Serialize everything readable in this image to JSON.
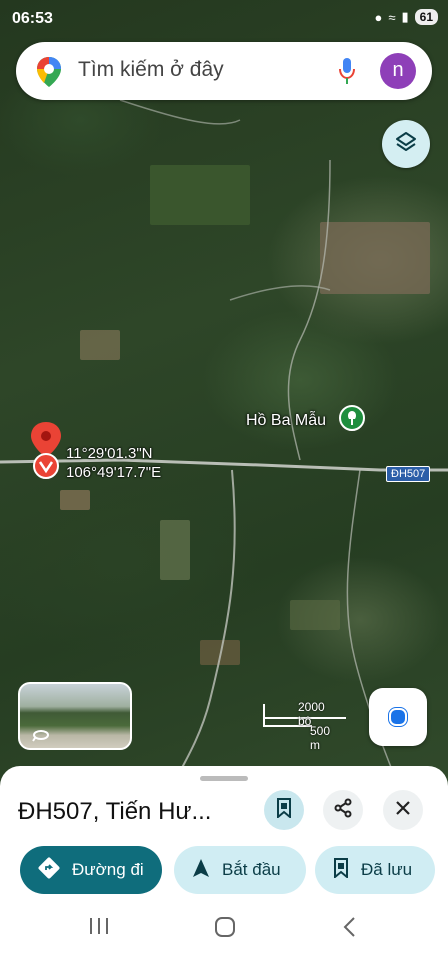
{
  "status_bar": {
    "time": "06:53",
    "battery": "61"
  },
  "search": {
    "placeholder": "Tìm kiếm ở đây",
    "avatar_letter": "n"
  },
  "map": {
    "coordinates_lat": "11°29'01.3\"N",
    "coordinates_lng": "106°49'17.7\"E",
    "poi_label": "Hồ Ba Mẫu",
    "road_badge": "ĐH507",
    "scale_feet": "2000 bộ",
    "scale_meters": "500 m"
  },
  "sheet": {
    "place_title": "ĐH507, Tiến Hư...",
    "buttons": {
      "directions": "Đường đi",
      "start": "Bắt đầu",
      "saved": "Đã lưu"
    }
  },
  "colors": {
    "accent": "#0f6d7c",
    "pin": "#ea4335",
    "avatar": "#8e3fb8",
    "chip_bg": "#d0edf3"
  },
  "icons": [
    "maps-pin-icon",
    "mic-icon",
    "layers-icon",
    "location-pin-icon",
    "poi-park-icon",
    "street-view-icon",
    "my-location-icon",
    "bookmark-icon",
    "share-icon",
    "close-icon",
    "directions-icon",
    "navigate-icon",
    "recent-apps-icon",
    "home-icon",
    "back-icon"
  ]
}
